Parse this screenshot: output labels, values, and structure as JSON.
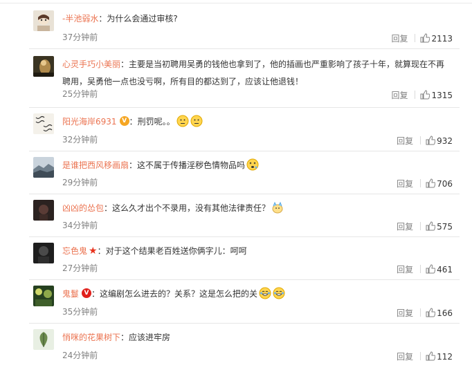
{
  "labels": {
    "reply": "回复"
  },
  "colors": {
    "username": "#eb7350",
    "meta": "#808080",
    "gold_badge": "#f5a623",
    "red_badge": "#e0201b"
  },
  "comments": [
    {
      "user": "-半池弱水",
      "text": "为什么会通过审核?",
      "time": "37分钟前",
      "likes": "2113",
      "badge": ""
    },
    {
      "user": "心灵手巧小美丽",
      "text": "主要是当初聘用吴勇的钱他也拿到了，他的插画也严重影响了孩子十年，就算现在不再聘用，吴勇他一点也没亏啊，所有目的都达到了，应该让他退钱！",
      "time": "25分钟前",
      "likes": "1315",
      "badge": ""
    },
    {
      "user": "阳光海岸6931",
      "text": "刑罚呢。。",
      "time": "32分钟前",
      "likes": "932",
      "badge": "gold",
      "emoji_icons": [
        "thinking-emoji-icon",
        "thinking-emoji-icon"
      ]
    },
    {
      "user": "是谁把西风移画扇",
      "text": "这不属于传播淫秽色情物品吗",
      "time": "29分钟前",
      "likes": "706",
      "badge": "",
      "emoji_icons": [
        "dizzy-emoji-icon"
      ]
    },
    {
      "user": "凶凶的怂包",
      "text": "这么久才出个不录用，没有其他法律责任？",
      "time": "34分钟前",
      "likes": "575",
      "badge": "",
      "emoji_icons": [
        "doge-emoji-icon"
      ]
    },
    {
      "user": "忘色鬼",
      "text": "对于这个结果老百姓送你俩字儿：呵呵",
      "time": "27分钟前",
      "likes": "461",
      "badge": "star"
    },
    {
      "user": "鬼鬘",
      "text": "这编剧怎么进去的？关系？这是怎么把的关",
      "time": "35分钟前",
      "likes": "166",
      "badge": "red",
      "emoji_icons": [
        "laugh-cry-emoji-icon",
        "laugh-cry-emoji-icon"
      ]
    },
    {
      "user": "悄咪的花果树下",
      "text": "应该进牢房",
      "time": "24分钟前",
      "likes": "112",
      "badge": ""
    }
  ]
}
